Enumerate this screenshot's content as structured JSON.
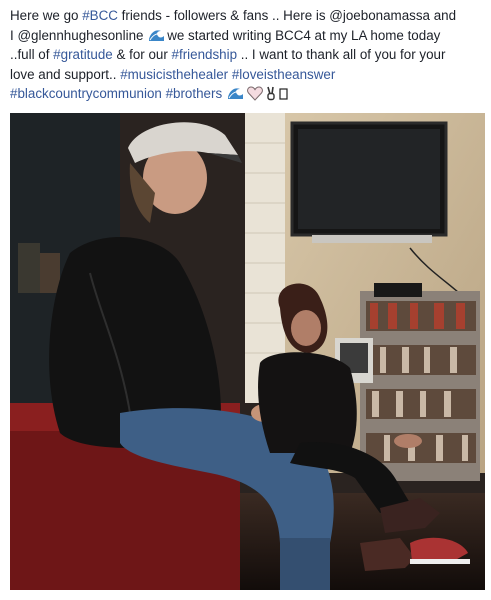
{
  "post": {
    "caption": {
      "line1_pre": "Here we go ",
      "tag_bcc": "#BCC",
      "line1_post": " friends - followers & fans .. Here is @joebonamassa and",
      "line2_pre": "I @glennhughesonline ",
      "line2_post": "we started writing BCC4 at my LA home today",
      "line3_pre": "..full of ",
      "tag_gratitude": "#gratitude",
      "line3_mid": " & for our ",
      "tag_friendship": "#friendship",
      "line3_post": " .. I want to thank all of you for your",
      "line4_pre": "love and support.. ",
      "tag_musicisthehealer": "#musicisthehealer",
      "tag_loveistheanswer": "#loveistheanswer",
      "tag_blackcountrycommunion": "#blackcountrycommunion",
      "tag_brothers": "#brothers"
    },
    "emojis": [
      "wave-icon",
      "wave-icon",
      "heart-icon",
      "victory-hand-icon",
      "unknown-glyph-icon"
    ],
    "photo": {
      "subject": "photo-two-musicians-seated-in-studio"
    },
    "colors": {
      "hashtag": "#365899",
      "text": "#1d2129"
    }
  }
}
